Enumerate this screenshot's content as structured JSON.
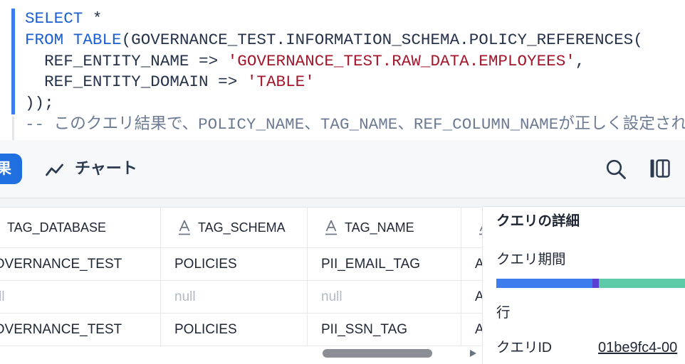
{
  "colors": {
    "accent": "#1f6fe0",
    "gutter_active": "#3b7ded",
    "sql_keyword": "#1c5fd3",
    "sql_string": "#a3182c",
    "sql_text": "#26324a",
    "sql_comment": "#6c7b93",
    "null_text": "#b3b9c3"
  },
  "editor": {
    "lines": [
      {
        "tokens": [
          {
            "type": "keyword",
            "text": "SELECT"
          },
          {
            "type": "text",
            "text": " *"
          }
        ]
      },
      {
        "tokens": [
          {
            "type": "keyword",
            "text": "FROM"
          },
          {
            "type": "text",
            "text": " "
          },
          {
            "type": "keyword",
            "text": "TABLE"
          },
          {
            "type": "text",
            "text": "(GOVERNANCE_TEST.INFORMATION_SCHEMA.POLICY_REFERENCES("
          }
        ]
      },
      {
        "tokens": [
          {
            "type": "text",
            "text": "  REF_ENTITY_NAME => "
          },
          {
            "type": "string",
            "text": "'GOVERNANCE_TEST.RAW_DATA.EMPLOYEES'"
          },
          {
            "type": "text",
            "text": ","
          }
        ]
      },
      {
        "tokens": [
          {
            "type": "text",
            "text": "  REF_ENTITY_DOMAIN => "
          },
          {
            "type": "string",
            "text": "'TABLE'"
          }
        ]
      },
      {
        "tokens": [
          {
            "type": "text",
            "text": "));"
          }
        ]
      },
      {
        "tokens": [
          {
            "type": "comment",
            "text": "-- このクエリ結果で、POLICY_NAME、TAG_NAME、REF_COLUMN_NAMEが正しく設定され"
          }
        ]
      }
    ]
  },
  "toolbar": {
    "results_tab": "結果",
    "chart_tab": "チャート",
    "chart_icon": "line-chart-icon",
    "search_icon": "search-icon",
    "columns_icon": "columns-icon"
  },
  "results": {
    "columns": [
      {
        "name": "TAG_DATABASE",
        "type_icon": "text-type-icon"
      },
      {
        "name": "TAG_SCHEMA",
        "type_icon": "text-type-icon"
      },
      {
        "name": "TAG_NAME",
        "type_icon": "text-type-icon"
      },
      {
        "type_icon": "text-type-icon"
      }
    ],
    "rows": [
      [
        "GOVERNANCE_TEST",
        "POLICIES",
        "PII_EMAIL_TAG",
        "A"
      ],
      [
        "null",
        "null",
        "null",
        "A"
      ],
      [
        "GOVERNANCE_TEST",
        "POLICIES",
        "PII_SSN_TAG",
        "A"
      ]
    ],
    "scroll_right_icon": "caret-right-icon"
  },
  "query_details": {
    "title": "クエリの詳細",
    "duration_label": "クエリ期間",
    "duration_breakdown": [
      {
        "fraction": 0.51,
        "color": "#3d7cec"
      },
      {
        "fraction": 0.034,
        "color": "#5a3fd0"
      },
      {
        "fraction": 0.456,
        "color": "#5ccaa8"
      }
    ],
    "rows_label": "行",
    "query_id_label": "クエリID",
    "query_id": "01be9fc4-00"
  }
}
